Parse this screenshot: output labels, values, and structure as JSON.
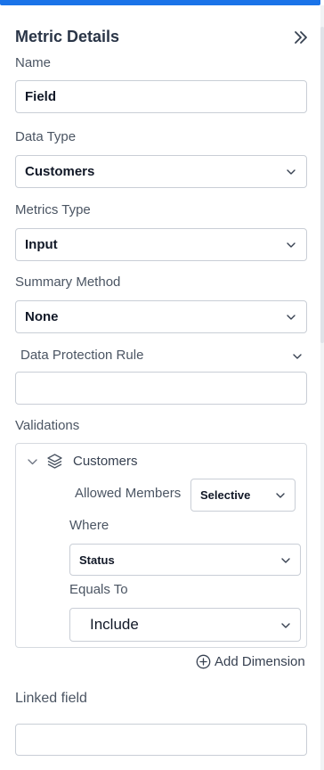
{
  "panel": {
    "title": "Metric Details",
    "collapse_icon": "double-chevron-right-icon"
  },
  "name": {
    "label": "Name",
    "value": "Field"
  },
  "data_type": {
    "label": "Data Type",
    "value": "Customers"
  },
  "metrics_type": {
    "label": "Metrics Type",
    "value": "Input"
  },
  "summary_method": {
    "label": "Summary Method",
    "value": "None"
  },
  "data_protection": {
    "label": "Data Protection Rule",
    "value": ""
  },
  "validations": {
    "label": "Validations",
    "tree_item": "Customers",
    "allowed_members_label": "Allowed Members",
    "allowed_members_value": "Selective",
    "where_label": "Where",
    "where_value": "Status",
    "equals_label": "Equals To",
    "equals_value": "Include",
    "add_dimension": "Add Dimension"
  },
  "linked_field": {
    "label": "Linked field",
    "value": ""
  },
  "colors": {
    "accent": "#1a73e8",
    "border": "#c9ced6",
    "title": "#2a3547"
  }
}
